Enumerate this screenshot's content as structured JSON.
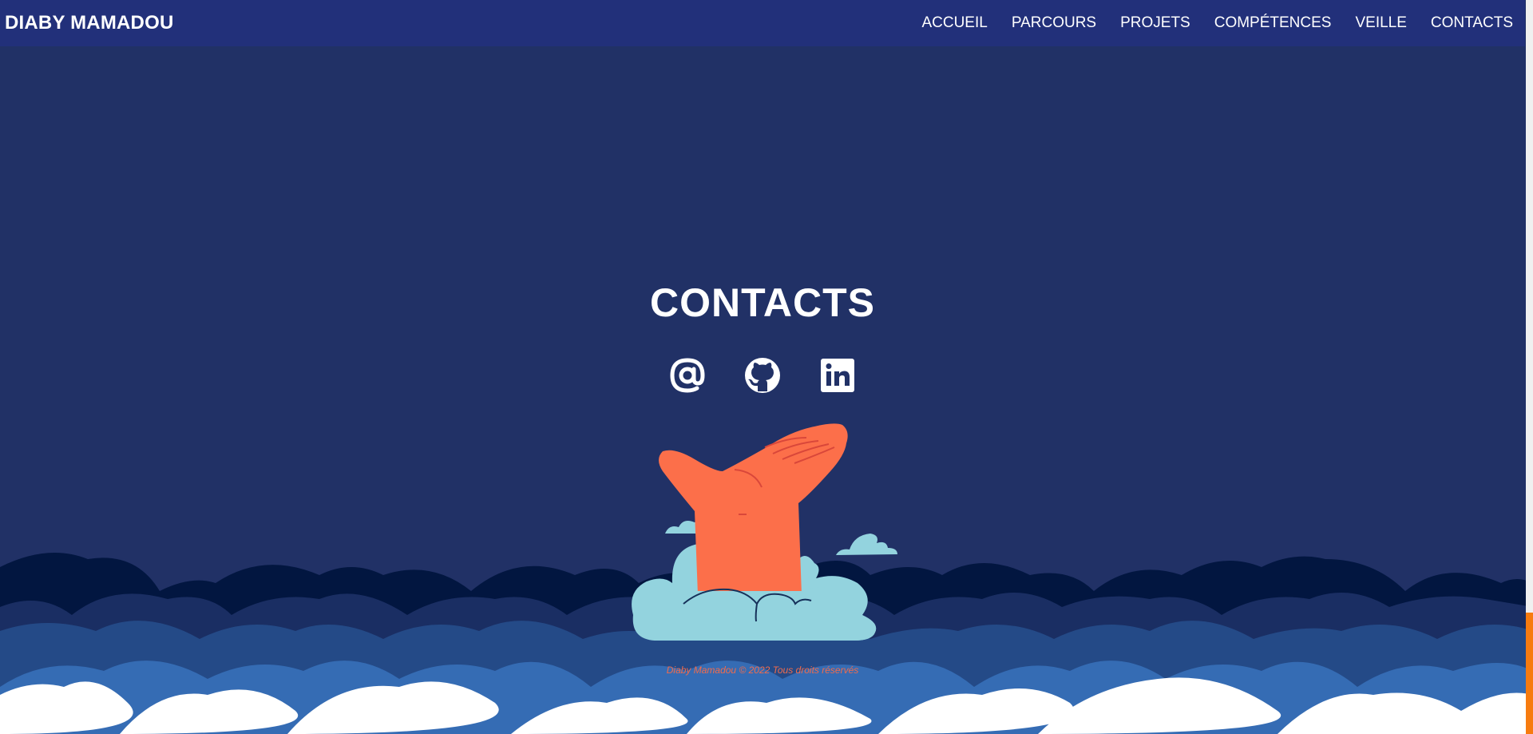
{
  "brand": "DIABY MAMADOU",
  "nav": {
    "items": [
      "ACCUEIL",
      "PARCOURS",
      "PROJETS",
      "COMPÉTENCES",
      "VEILLE",
      "CONTACTS"
    ]
  },
  "section": {
    "title": "CONTACTS"
  },
  "socials": [
    {
      "icon": "at-sign-icon"
    },
    {
      "icon": "github-icon"
    },
    {
      "icon": "linkedin-icon"
    }
  ],
  "footer": {
    "text": "Diaby Mamadou © 2022 Tous droits réservés"
  },
  "colors": {
    "background": "#213166",
    "navbar": "#22307a",
    "accent": "#f26b4b",
    "hand": "#fc6f4a",
    "cloud": "#93d3de",
    "scroll_thumb": "#f77b0f"
  }
}
